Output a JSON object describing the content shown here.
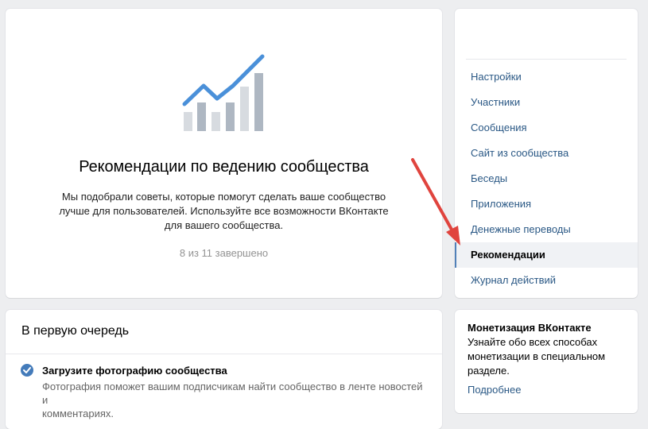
{
  "hero": {
    "title": "Рекомендации по ведению сообщества",
    "desc_line1": "Мы подобрали советы, которые помогут сделать ваше сообщество",
    "desc_line2": "лучше для пользователей. Используйте все возможности ВКонтакте",
    "desc_line3": "для вашего сообщества.",
    "progress": "8 из 11 завершено",
    "icon": "growth-chart-icon",
    "colors": {
      "line": "#4a90d9",
      "bar_dark": "#aeb7c2",
      "bar_light": "#d7dbe0"
    }
  },
  "priority": {
    "header": "В первую очередь",
    "tasks": [
      {
        "title": "Загрузите фотографию сообщества",
        "desc_line1": "Фотография поможет вашим подписчикам найти сообщество в ленте новостей и",
        "desc_line2": "комментариях.",
        "done": true
      }
    ]
  },
  "menu": {
    "items": [
      {
        "label": "Настройки"
      },
      {
        "label": "Участники"
      },
      {
        "label": "Сообщения"
      },
      {
        "label": "Сайт из сообщества"
      },
      {
        "label": "Беседы"
      },
      {
        "label": "Приложения"
      },
      {
        "label": "Денежные переводы"
      },
      {
        "label": "Рекомендации",
        "active": true
      },
      {
        "label": "Журнал действий"
      }
    ]
  },
  "monetization": {
    "title": "Монетизация ВКонтакте",
    "text_line1": "Узнайте обо всех способах",
    "text_line2": "монетизации в специальном",
    "text_line3": "разделе.",
    "link": "Подробнее"
  },
  "colors": {
    "accent": "#2a5885",
    "check": "#447bba",
    "annotation_arrow": "#e0443e",
    "background": "#edeef0"
  }
}
